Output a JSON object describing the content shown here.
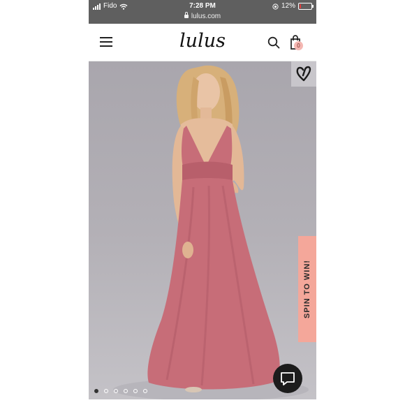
{
  "status_bar": {
    "carrier": "Fido",
    "time": "7:28 PM",
    "battery_percent": "12%",
    "battery_level": 0.12,
    "icons": [
      "signal-icon",
      "wifi-icon",
      "orientation-lock-icon",
      "battery-icon"
    ]
  },
  "browser": {
    "url": "lulus.com",
    "lock_icon": "lock-icon"
  },
  "header": {
    "logo": "lulus",
    "cart_count": "0",
    "icons": [
      "menu-icon",
      "search-icon",
      "shopping-bag-icon"
    ]
  },
  "product": {
    "dress_color": "#c76d78",
    "background_color": "#b0adb3",
    "wishlist_icon": "heart-icon",
    "image_count": 6,
    "active_image": 1
  },
  "promo": {
    "label": "SPIN TO WIN!",
    "color": "#f4a79a"
  },
  "chat": {
    "icon": "chat-bubble-icon"
  }
}
